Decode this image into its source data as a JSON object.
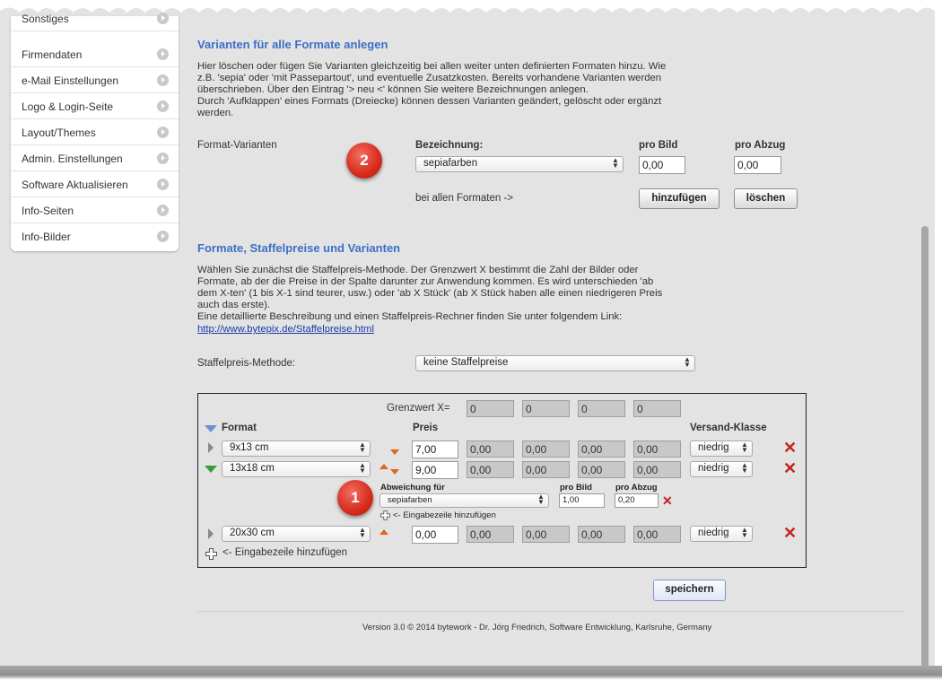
{
  "sidebar": {
    "items": [
      {
        "label": "Sonstiges"
      },
      {
        "label": "Firmendaten"
      },
      {
        "label": "e-Mail Einstellungen"
      },
      {
        "label": "Logo & Login-Seite"
      },
      {
        "label": "Layout/Themes"
      },
      {
        "label": "Admin. Einstellungen"
      },
      {
        "label": "Software Aktualisieren"
      },
      {
        "label": "Info-Seiten"
      },
      {
        "label": "Info-Bilder"
      }
    ]
  },
  "variants": {
    "heading": "Varianten für alle Formate anlegen",
    "description": [
      "Hier löschen oder fügen Sie Varianten gleichzeitig bei allen weiter unten definierten Formaten hinzu. Wie",
      "z.B. 'sepia' oder 'mit Passepartout', und eventuelle Zusatzkosten. Bereits vorhandene Varianten werden",
      "überschrieben. Über den Eintrag '> neu <' können Sie weitere Bezeichnungen anlegen.",
      "Durch 'Aufklappen' eines Formats (Dreiecke) können dessen Varianten geändert, gelöscht oder ergänzt",
      "werden."
    ],
    "row_label": "Format-Varianten",
    "col_bezeichnung": "Bezeichnung:",
    "col_pro_bild": "pro Bild",
    "col_pro_abzug": "pro Abzug",
    "select_value": "sepiafarben",
    "pro_bild_value": "0,00",
    "pro_abzug_value": "0,00",
    "all_formats_label": "bei allen Formaten ->",
    "add_button": "hinzufügen",
    "delete_button": "löschen",
    "badge": "2"
  },
  "formats": {
    "heading": "Formate, Staffelpreise und Varianten",
    "description": [
      "Wählen Sie zunächst die Staffelpreis-Methode. Der Grenzwert X bestimmt die Zahl der Bilder oder",
      "Formate, ab der die Preise in der Spalte darunter zur Anwendung kommen. Es wird unterschieden 'ab",
      "dem X-ten' (1 bis X-1 sind teurer, usw.) oder 'ab X Stück' (ab X Stück haben alle einen niedrigeren Preis",
      "auch das erste).",
      "Eine detaillierte Beschreibung und einen Staffelpreis-Rechner finden Sie unter folgendem Link:"
    ],
    "link": "http://www.bytepix.de/Staffelpreise.html",
    "method_label": "Staffelpreis-Methode:",
    "method_value": "keine Staffelpreise"
  },
  "table": {
    "grenzwert_label": "Grenzwert X=",
    "grenzwerte": [
      "0",
      "0",
      "0",
      "0"
    ],
    "col_format": "Format",
    "col_preis": "Preis",
    "col_versand": "Versand-Klasse",
    "rows": [
      {
        "format": "9x13 cm",
        "preis": "7,00",
        "staffel": [
          "0,00",
          "0,00",
          "0,00",
          "0,00"
        ],
        "versand": "niedrig"
      },
      {
        "format": "13x18 cm",
        "preis": "9,00",
        "staffel": [
          "0,00",
          "0,00",
          "0,00",
          "0,00"
        ],
        "versand": "niedrig"
      },
      {
        "format": "20x30 cm",
        "preis": "0,00",
        "staffel": [
          "0,00",
          "0,00",
          "0,00",
          "0,00"
        ],
        "versand": "niedrig"
      }
    ],
    "sub": {
      "label": "Abweichung für",
      "pro_bild_label": "pro Bild",
      "pro_abzug_label": "pro Abzug",
      "select_value": "sepiafarben",
      "pro_bild_value": "1,00",
      "pro_abzug_value": "0,20",
      "add_line": "<- Eingabezeile hinzufügen",
      "badge": "1"
    },
    "add_line": "<- Eingabezeile hinzufügen"
  },
  "save_button": "speichern",
  "footer": "Version 3.0 © 2014 bytework - Dr. Jörg Friedrich, Software Entwicklung, Karlsruhe, Germany"
}
